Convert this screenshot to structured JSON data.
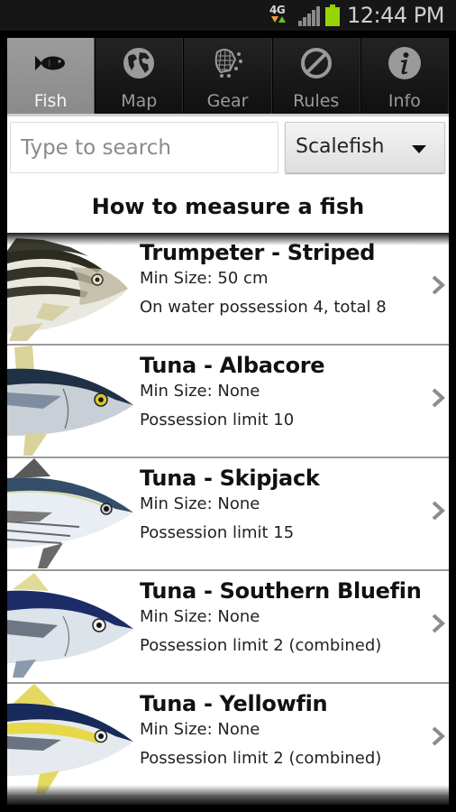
{
  "status_bar": {
    "network_label": "4G",
    "time": "12:44 PM",
    "icons": [
      "network-4g-icon",
      "signal-icon",
      "battery-icon"
    ]
  },
  "tabs": [
    {
      "label": "Fish",
      "icon": "fish-icon",
      "active": true
    },
    {
      "label": "Map",
      "icon": "globe-icon",
      "active": false
    },
    {
      "label": "Gear",
      "icon": "net-gear-icon",
      "active": false
    },
    {
      "label": "Rules",
      "icon": "prohibited-icon",
      "active": false
    },
    {
      "label": "Info",
      "icon": "info-icon",
      "active": false
    }
  ],
  "search": {
    "placeholder": "Type to search",
    "value": ""
  },
  "category_select": {
    "selected": "Scalefish"
  },
  "measure_link": "How to measure a fish",
  "colors": {
    "tab_active_bg": "#929292",
    "tab_bg": "#1a1a1a",
    "status_battery": "#9ad400"
  },
  "fish_list": [
    {
      "name": "Trumpeter - Striped",
      "min_size_label": "Min Size:",
      "min_size": "50 cm",
      "limit": "On water possession 4, total 8"
    },
    {
      "name": "Tuna - Albacore",
      "min_size_label": "Min Size:",
      "min_size": "None",
      "limit": "Possession limit 10"
    },
    {
      "name": "Tuna - Skipjack",
      "min_size_label": "Min Size:",
      "min_size": "None",
      "limit": "Possession limit 15"
    },
    {
      "name": "Tuna - Southern Bluefin",
      "min_size_label": "Min Size:",
      "min_size": "None",
      "limit": "Possession limit 2 (combined)"
    },
    {
      "name": "Tuna - Yellowfin",
      "min_size_label": "Min Size:",
      "min_size": "None",
      "limit": "Possession limit 2 (combined)"
    }
  ]
}
